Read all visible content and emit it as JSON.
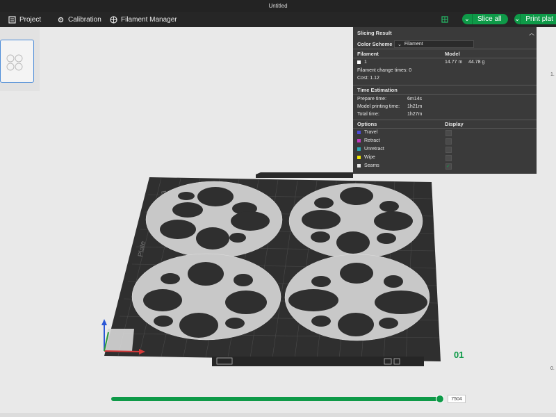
{
  "window": {
    "title": "Untitled"
  },
  "toolbar": {
    "project": "Project",
    "calibration": "Calibration",
    "filament_manager": "Filament Manager",
    "slice_all": "Slice all",
    "print_plate": "Print plat"
  },
  "slicing": {
    "title": "Slicing Result",
    "color_scheme_label": "Color Scheme",
    "color_scheme_value": "Filament",
    "filament_header": "Filament",
    "model_header": "Model",
    "filament_index": "1",
    "length": "14.77 m",
    "weight": "44.78 g",
    "change_times": "Filament change times:  0",
    "cost": "Cost:  1.12",
    "time_header": "Time Estimation",
    "prepare_label": "Prepare time:",
    "prepare_value": "6m14s",
    "model_print_label": "Model printing time:",
    "model_print_value": "1h21m",
    "total_label": "Total time:",
    "total_value": "1h27m",
    "options_header": "Options",
    "display_header": "Display",
    "options": [
      {
        "label": "Travel",
        "color": "#4b4bd8",
        "checked": false
      },
      {
        "label": "Retract",
        "color": "#c23ac2",
        "checked": false
      },
      {
        "label": "Unretract",
        "color": "#2aa7b5",
        "checked": false
      },
      {
        "label": "Wipe",
        "color": "#f2e600",
        "checked": false
      },
      {
        "label": "Seams",
        "color": "#e8e8e8",
        "checked": true
      }
    ]
  },
  "plate": {
    "number": "01",
    "brand_text": "Bambu",
    "plate_text": "Plate"
  },
  "layer_slider": {
    "value": "7504",
    "fraction": 1.0
  },
  "right_marks": {
    "top": "1.",
    "bottom": "0."
  },
  "colors": {
    "accent": "#0e9a48",
    "panel": "#3a3a3a",
    "bed": "#2f2f2f",
    "part": "#c8c8c8"
  }
}
